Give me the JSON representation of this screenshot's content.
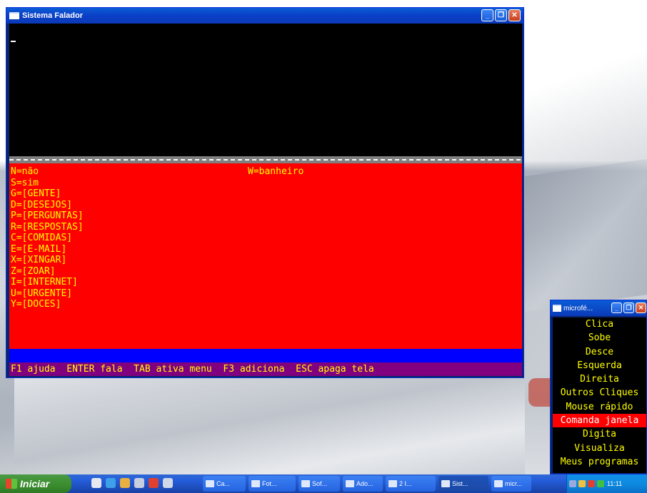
{
  "main_window": {
    "title": "Sistema Falador",
    "menu_left": [
      "N=não",
      "S=sim",
      "G=[GENTE]",
      "D=[DESEJOS]",
      "P=[PERGUNTAS]",
      "R=[RESPOSTAS]",
      "C=[COMIDAS]",
      "E=[E-MAIL]",
      "X=[XINGAR]",
      "Z=[ZOAR]",
      "I=[INTERNET]",
      "U=[URGENTE]",
      "Y=[DOCES]"
    ],
    "menu_right": "W=banheiro",
    "status_bar": "F1 ajuda  ENTER fala  TAB ativa menu  F3 adiciona  ESC apaga tela"
  },
  "mouse_window": {
    "title": "microfé...",
    "items": [
      "Clica",
      "Sobe",
      "Desce",
      "Esquerda",
      "Direita",
      "Outros Cliques",
      "Mouse rápido",
      "Comanda janela",
      "Digita",
      "Visualiza",
      "Meus programas"
    ],
    "selected_index": 7
  },
  "taskbar": {
    "start_label": "Iniciar",
    "tasks": [
      {
        "label": "Ca...",
        "active": false
      },
      {
        "label": "Fot...",
        "active": false
      },
      {
        "label": "Sof...",
        "active": false
      },
      {
        "label": "Ado...",
        "active": false
      },
      {
        "label": "2 I...",
        "active": false
      },
      {
        "label": "Sist...",
        "active": true
      },
      {
        "label": "micr...",
        "active": false
      }
    ],
    "clock": "11:11"
  },
  "colors": {
    "console_red": "#ff0000",
    "text_yellow": "#ffff00",
    "status_purple": "#800080",
    "band_blue": "#0000ff"
  }
}
